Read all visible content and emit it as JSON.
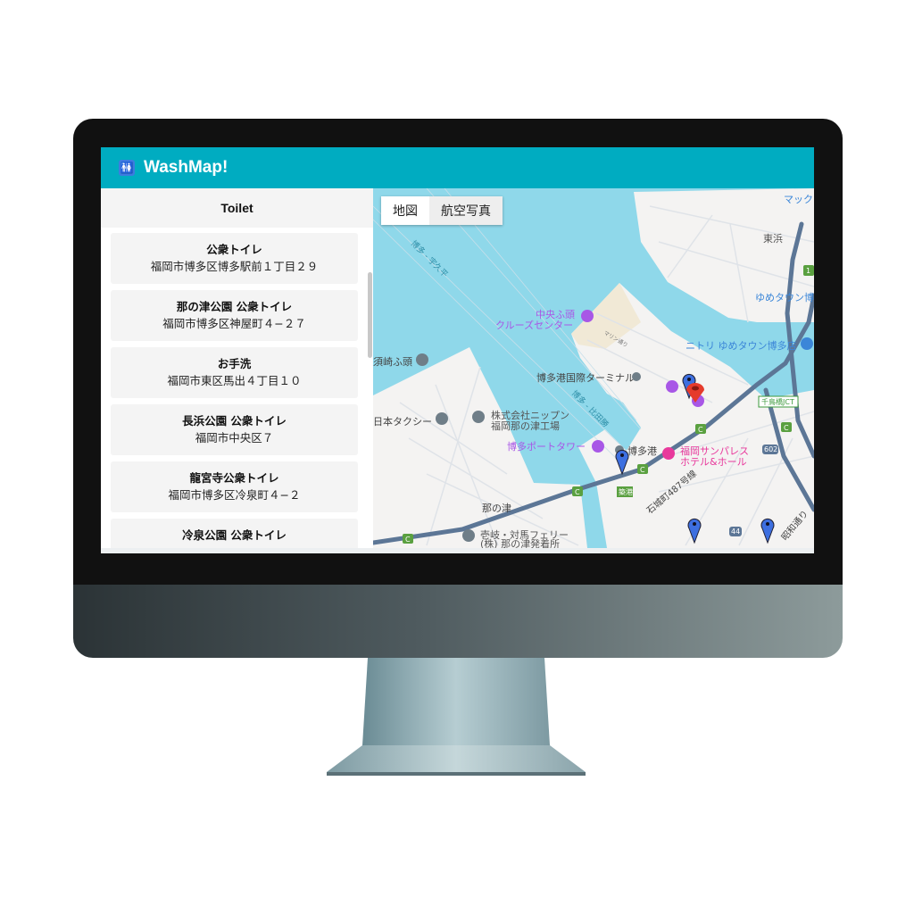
{
  "app": {
    "title": "WashMap!",
    "logo_icon": "restroom-icon"
  },
  "sidebar": {
    "header": "Toilet",
    "items": [
      {
        "name": "公衆トイレ",
        "address": "福岡市博多区博多駅前１丁目２９"
      },
      {
        "name": "那の津公園 公衆トイレ",
        "address": "福岡市博多区神屋町４−２７"
      },
      {
        "name": "お手洗",
        "address": "福岡市東区馬出４丁目１０"
      },
      {
        "name": "長浜公園 公衆トイレ",
        "address": "福岡市中央区７"
      },
      {
        "name": "龍宮寺公衆トイレ",
        "address": "福岡市博多区冷泉町４−２"
      },
      {
        "name": "冷泉公園 公衆トイレ",
        "address": ""
      }
    ]
  },
  "map": {
    "type_buttons": [
      {
        "label": "地図",
        "active": true
      },
      {
        "label": "航空写真",
        "active": false
      }
    ],
    "labels": {
      "route1": "博多 - 宇久平",
      "route2": "博多 - 比田勝",
      "higashihama": "東浜",
      "mac": "マック",
      "yumetown": "ゆめタウン博",
      "nitori": "ニトリ ゆめタウン博多店",
      "chuo1": "中央ふ頭",
      "chuo2": "クルーズセンター",
      "marine": "マリン通り",
      "terminal": "博多港国際ターミナル",
      "sukizaki": "須崎ふ頭",
      "nihontaxi": "日本タクシー",
      "nippun1": "株式会社ニップン",
      "nippun2": "福岡那の津工場",
      "porttower": "博多ポートタワー",
      "hakatako": "博多港",
      "sunpalace1": "福岡サンパレス",
      "sunpalace2": "ホテル&ホール",
      "chidoribashi": "千鳥橋JCT",
      "chikko": "築港",
      "sekijo": "石城町487号線",
      "nanotsu": "那の津",
      "ferry1": "壱岐・対馬フェリー",
      "ferry2": "(株) 那の津発着所",
      "showa": "昭和通り",
      "r602": "602",
      "r44": "44",
      "r1": "1",
      "c": "C"
    },
    "colors": {
      "water": "#8fd8ea",
      "land": "#f4f3f2",
      "highway": "#5c7696",
      "poi_purple": "#a857e6",
      "hotel": "#e8399c",
      "pin_blue": "#3d6fe0",
      "pin_red": "#e53b2c"
    }
  }
}
